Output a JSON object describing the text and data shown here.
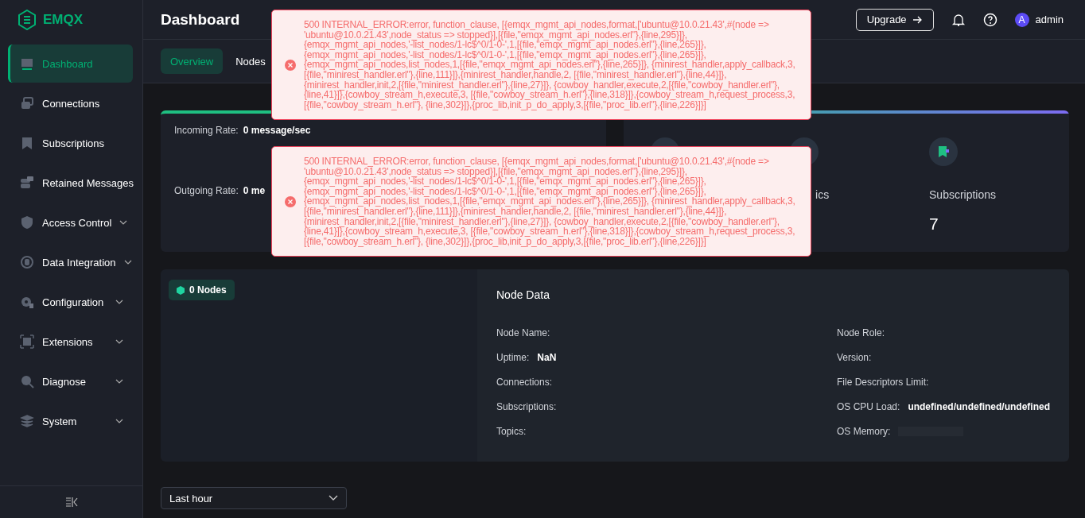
{
  "sidebar": {
    "logo": "EMQX",
    "items": [
      {
        "label": "Dashboard",
        "selected": true,
        "submenu": false
      },
      {
        "label": "Connections",
        "selected": false,
        "submenu": false
      },
      {
        "label": "Subscriptions",
        "selected": false,
        "submenu": false
      },
      {
        "label": "Retained Messages",
        "selected": false,
        "submenu": false
      },
      {
        "label": "Access Control",
        "selected": false,
        "submenu": true
      },
      {
        "label": "Data Integration",
        "selected": false,
        "submenu": true
      },
      {
        "label": "Configuration",
        "selected": false,
        "submenu": true
      },
      {
        "label": "Extensions",
        "selected": false,
        "submenu": true
      },
      {
        "label": "Diagnose",
        "selected": false,
        "submenu": true
      },
      {
        "label": "System",
        "selected": false,
        "submenu": true
      }
    ]
  },
  "header": {
    "title": "Dashboard",
    "upgrade": "Upgrade",
    "user": {
      "initial": "A",
      "name": "admin"
    }
  },
  "tabs": [
    {
      "label": "Overview",
      "selected": true
    },
    {
      "label": "Nodes",
      "selected": false
    }
  ],
  "rates": [
    {
      "label": "Incoming Rate:",
      "value": "0 message/sec"
    },
    {
      "label": "Outgoing Rate:",
      "value": "0 me"
    }
  ],
  "stats": [
    {
      "label": "ics"
    },
    {
      "label": "Subscriptions",
      "value": "7"
    }
  ],
  "nodes": {
    "badge": "0 Nodes",
    "title": "Node Data",
    "left": [
      {
        "label": "Node Name:"
      },
      {
        "label": "Uptime:",
        "value": "NaN"
      },
      {
        "label": "Connections:"
      },
      {
        "label": "Subscriptions:"
      },
      {
        "label": "Topics:"
      }
    ],
    "right": [
      {
        "label": "Node Role:"
      },
      {
        "label": "Version:"
      },
      {
        "label": "File Descriptors Limit:"
      },
      {
        "label": "OS CPU Load:",
        "value": "undefined/undefined/undefined"
      },
      {
        "label": "OS Memory:",
        "kind": "bar"
      }
    ]
  },
  "time_range": "Last hour",
  "errors": [
    {
      "message": "500 INTERNAL_ERROR:error, function_clause, [{emqx_mgmt_api_nodes,format,['ubuntu@10.0.21.43',#{node => 'ubuntu@10.0.21.43',node_status => stopped}],[{file,\"emqx_mgmt_api_nodes.erl\"},{line,295}]}, {emqx_mgmt_api_nodes,'-list_nodes/1-lc$^0/1-0-',1,[{file,\"emqx_mgmt_api_nodes.erl\"},{line,265}]}, {emqx_mgmt_api_nodes,'-list_nodes/1-lc$^0/1-0-',1,[{file,\"emqx_mgmt_api_nodes.erl\"},{line,265}]}, {emqx_mgmt_api_nodes,list_nodes,1,[{file,\"emqx_mgmt_api_nodes.erl\"},{line,265}]}, {minirest_handler,apply_callback,3,[{file,\"minirest_handler.erl\"},{line,111}]},{minirest_handler,handle,2, [{file,\"minirest_handler.erl\"},{line,44}]},{minirest_handler,init,2,[{file,\"minirest_handler.erl\"},{line,27}]}, {cowboy_handler,execute,2,[{file,\"cowboy_handler.erl\"},{line,41}]},{cowboy_stream_h,execute,3, [{file,\"cowboy_stream_h.erl\"},{line,318}]},{cowboy_stream_h,request_process,3,[{file,\"cowboy_stream_h.erl\"}, {line,302}]},{proc_lib,init_p_do_apply,3,[{file,\"proc_lib.erl\"},{line,226}]}]"
    },
    {
      "message": "500 INTERNAL_ERROR:error, function_clause, [{emqx_mgmt_api_nodes,format,['ubuntu@10.0.21.43',#{node => 'ubuntu@10.0.21.43',node_status => stopped}],[{file,\"emqx_mgmt_api_nodes.erl\"},{line,295}]}, {emqx_mgmt_api_nodes,'-list_nodes/1-lc$^0/1-0-',1,[{file,\"emqx_mgmt_api_nodes.erl\"},{line,265}]}, {emqx_mgmt_api_nodes,'-list_nodes/1-lc$^0/1-0-',1,[{file,\"emqx_mgmt_api_nodes.erl\"},{line,265}]}, {emqx_mgmt_api_nodes,list_nodes,1,[{file,\"emqx_mgmt_api_nodes.erl\"},{line,265}]}, {minirest_handler,apply_callback,3,[{file,\"minirest_handler.erl\"},{line,111}]},{minirest_handler,handle,2, [{file,\"minirest_handler.erl\"},{line,44}]},{minirest_handler,init,2,[{file,\"minirest_handler.erl\"},{line,27}]}, {cowboy_handler,execute,2,[{file,\"cowboy_handler.erl\"},{line,41}]},{cowboy_stream_h,execute,3, [{file,\"cowboy_stream_h.erl\"},{line,318}]},{cowboy_stream_h,request_process,3,[{file,\"cowboy_stream_h.erl\"}, {line,302}]},{proc_lib,init_p_do_apply,3,[{file,\"proc_lib.erl\"},{line,226}]}]"
    }
  ]
}
